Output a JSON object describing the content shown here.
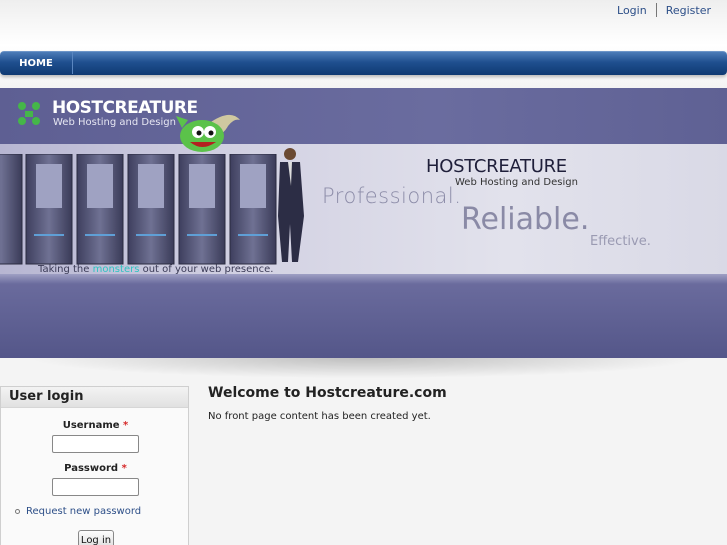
{
  "header": {
    "login_label": "Login",
    "register_label": "Register"
  },
  "nav": {
    "home_label": "HOME"
  },
  "banner": {
    "logo_title": "HOSTCREATURE",
    "logo_subtitle": "Web Hosting and Design",
    "title": "HOSTCREATURE",
    "subtitle": "Web Hosting and Design",
    "slogan_1": "Professional.",
    "slogan_2": "Reliable.",
    "slogan_3": "Effective.",
    "tagline_start": "Taking the ",
    "tagline_highlight": "monsters",
    "tagline_end": " out of your web presence."
  },
  "sidebar": {
    "title": "User login",
    "username_label": "Username",
    "password_label": "Password",
    "required_mark": "*",
    "request_password_label": "Request new password",
    "login_button_label": "Log in"
  },
  "main": {
    "title": "Welcome to Hostcreature.com",
    "text": "No front page content has been created yet."
  },
  "colors": {
    "nav_blue": "#1f4f8f",
    "banner_purple": "#575a8d",
    "link_blue": "#2d4f88",
    "required_red": "#d62a2a",
    "accent_teal": "#2ec4c2"
  }
}
